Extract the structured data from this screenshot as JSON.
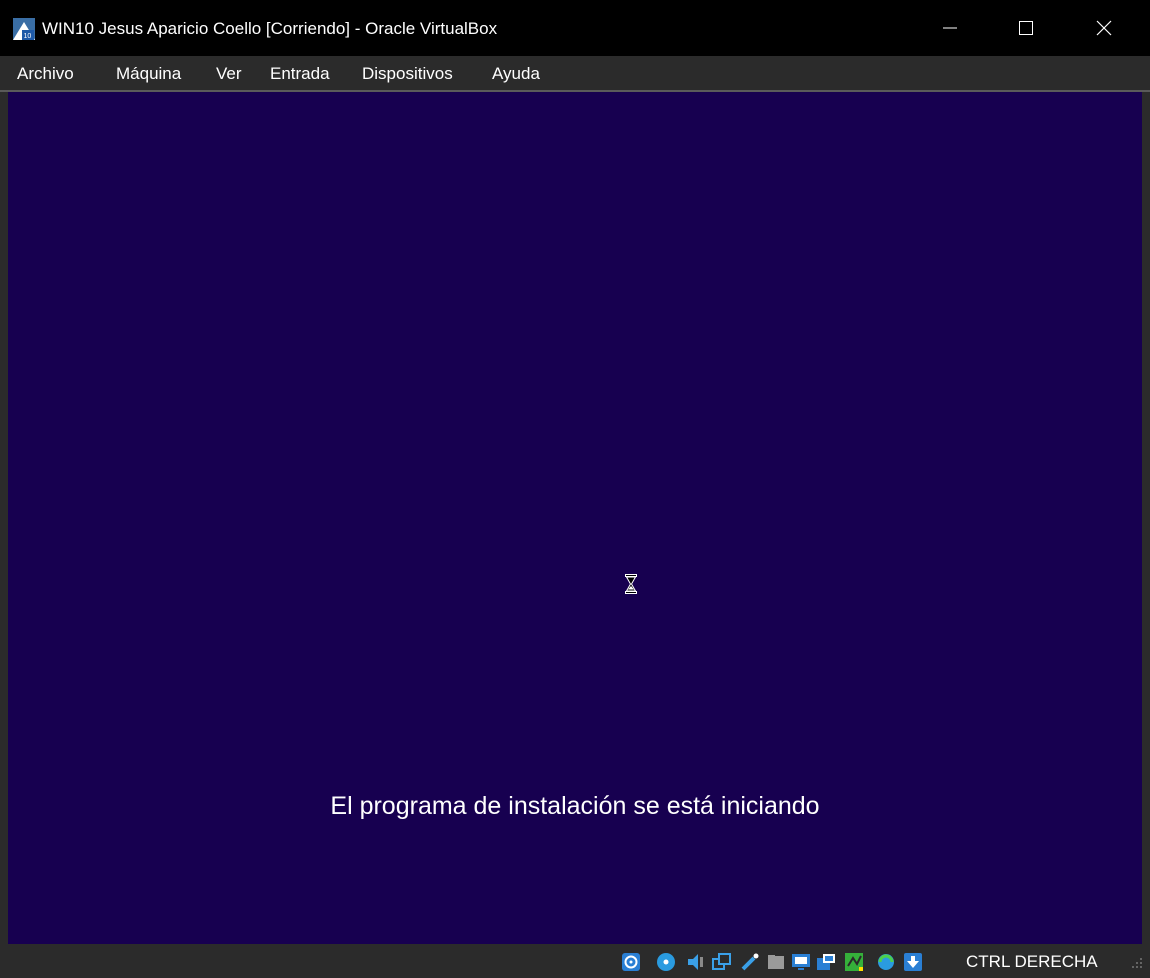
{
  "window": {
    "title": "WIN10 Jesus Aparicio Coello [Corriendo] - Oracle VirtualBox",
    "app_icon": "virtualbox-vm-icon",
    "controls": {
      "minimize": "minimize-icon",
      "maximize": "maximize-icon",
      "close": "close-icon"
    }
  },
  "menu": {
    "items": [
      "Archivo",
      "Máquina",
      "Ver",
      "Entrada",
      "Dispositivos",
      "Ayuda"
    ]
  },
  "guest_screen": {
    "background_color": "#170050",
    "message": "El programa de instalación se está iniciando",
    "cursor": "hourglass-cursor-icon"
  },
  "statusbar": {
    "icons": [
      "hard-disk-icon",
      "optical-drive-icon",
      "audio-icon",
      "network-icon",
      "usb-icon",
      "shared-folders-icon",
      "display-icon",
      "video-capture-icon",
      "mouse-integration-icon",
      "cpu-icon",
      "keyboard-capture-icon"
    ],
    "host_key": "CTRL DERECHA"
  },
  "colors": {
    "titlebar": "#000000",
    "menubar": "#2b2b2b",
    "guest_background": "#170050",
    "text": "#ffffff"
  }
}
